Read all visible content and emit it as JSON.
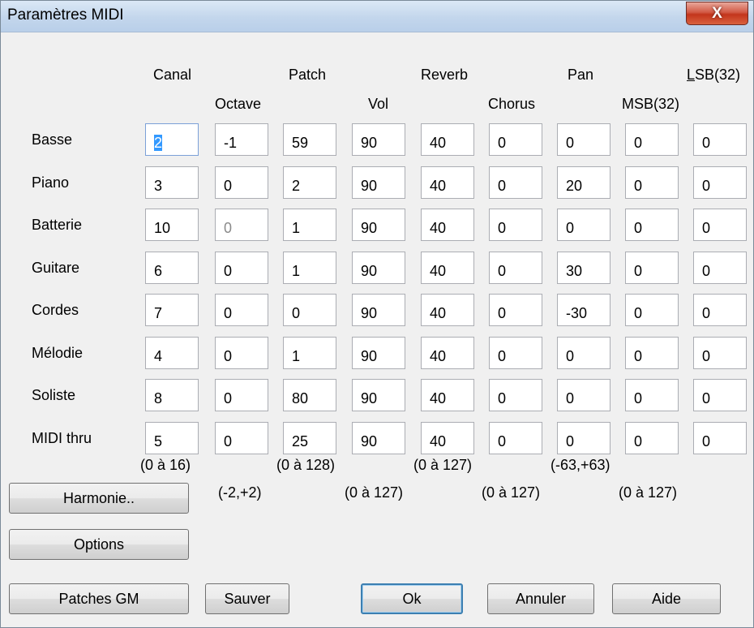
{
  "window": {
    "title": "Paramètres MIDI",
    "close_label": "X"
  },
  "columns_top": [
    "Canal",
    "Patch",
    "Reverb",
    "Pan",
    "LSB(32)"
  ],
  "columns_bottom": [
    "Octave",
    "Vol",
    "Chorus",
    "MSB(32)"
  ],
  "rows": [
    {
      "label": "Basse",
      "values": [
        "2",
        "-1",
        "59",
        "90",
        "40",
        "0",
        "0",
        "0",
        "0"
      ]
    },
    {
      "label": "Piano",
      "values": [
        "3",
        "0",
        "2",
        "90",
        "40",
        "0",
        "20",
        "0",
        "0"
      ]
    },
    {
      "label": "Batterie",
      "values": [
        "10",
        "0",
        "1",
        "90",
        "40",
        "0",
        "0",
        "0",
        "0"
      ]
    },
    {
      "label": "Guitare",
      "values": [
        "6",
        "0",
        "1",
        "90",
        "40",
        "0",
        "30",
        "0",
        "0"
      ]
    },
    {
      "label": "Cordes",
      "values": [
        "7",
        "0",
        "0",
        "90",
        "40",
        "0",
        "-30",
        "0",
        "0"
      ]
    },
    {
      "label": "Mélodie",
      "values": [
        "4",
        "0",
        "1",
        "90",
        "40",
        "0",
        "0",
        "0",
        "0"
      ]
    },
    {
      "label": "Soliste",
      "values": [
        "8",
        "0",
        "80",
        "90",
        "40",
        "0",
        "0",
        "0",
        "0"
      ]
    },
    {
      "label": "MIDI thru",
      "values": [
        "5",
        "0",
        "25",
        "90",
        "40",
        "0",
        "0",
        "0",
        "0"
      ]
    }
  ],
  "ranges_top": [
    "(0 à 16)",
    "(0 à 128)",
    "(0 à 127)",
    "(-63,+63)"
  ],
  "ranges_bottom": [
    "(-2,+2)",
    "(0 à 127)",
    "(0 à 127)",
    "(0 à 127)"
  ],
  "buttons": {
    "harmonie": "Harmonie..",
    "options": "Options",
    "patches_gm": "Patches GM",
    "sauver": "Sauver",
    "ok": "Ok",
    "annuler": "Annuler",
    "aide": "Aide"
  }
}
